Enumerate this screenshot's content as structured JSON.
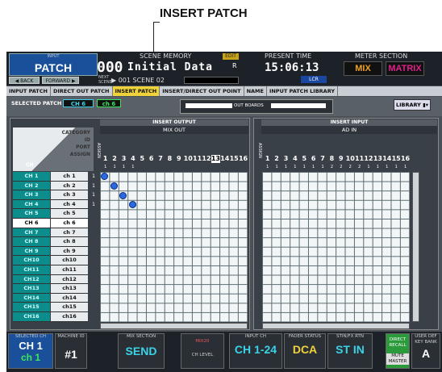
{
  "caption": "INSERT PATCH",
  "header": {
    "function_top": "INPUT",
    "function_name": "PATCH",
    "back": "◀ BACK",
    "forward": "FORWARD ▶",
    "scene_label": "SCENE MEMORY",
    "scene_number": "000",
    "scene_title": "Initial Data",
    "edit": "EDIT",
    "r": "R",
    "next_label_1": "NEXT",
    "next_label_2": "SCENE",
    "next_value": "▶ 001 SCENE 02",
    "time_label": "PRESENT TIME",
    "time": "15:06:13",
    "lcr": "LCR",
    "meter_label": "METER SECTION",
    "mix": "MIX",
    "matrix": "MATRIX",
    "colors": {
      "mix": "#f0a020",
      "matrix": "#e0208a"
    }
  },
  "tabs": [
    "INPUT PATCH",
    "DIRECT OUT PATCH",
    "INSERT PATCH",
    "INSERT/DIRECT OUT POINT",
    "NAME",
    "INPUT PATCH LIBRARY"
  ],
  "active_tab": "INSERT PATCH",
  "selected_patch": {
    "label": "SELECTED PATCH",
    "ch": "CH 6",
    "port": "ch 6"
  },
  "out_boards": "OUT BOARDS",
  "library": "LIBRARY",
  "row_labels": [
    "CATEGORY",
    "ID",
    "PORT",
    "ASSIGN"
  ],
  "ch_header": "CH",
  "insert_output": {
    "title": "INSERT OUTPUT",
    "sub": "MIX OUT",
    "assign": "ASSIGN",
    "numbers": [
      "1",
      "2",
      "3",
      "4",
      "5",
      "6",
      "7",
      "8",
      "9",
      "10",
      "11",
      "12",
      "13",
      "14",
      "15",
      "16"
    ],
    "ticks": [
      "1",
      "1",
      "1",
      "1",
      "",
      "",
      "",
      "",
      "",
      "",
      "",
      "",
      "",
      "",
      "",
      ""
    ]
  },
  "insert_input": {
    "title": "INSERT INPUT",
    "sub": "AD IN",
    "assign": "ASSIGN",
    "numbers": [
      "1",
      "2",
      "3",
      "4",
      "5",
      "6",
      "7",
      "8",
      "9",
      "10",
      "11",
      "12",
      "13",
      "14",
      "15",
      "16"
    ],
    "ticks": [
      "1",
      "1",
      "1",
      "1",
      "1",
      "1",
      "1",
      "2",
      "2",
      "2",
      "2",
      "1",
      "1",
      "1",
      "1",
      "1"
    ]
  },
  "channels": [
    "CH 1",
    "CH 2",
    "CH 3",
    "CH 4",
    "CH 5",
    "CH 6",
    "CH 7",
    "CH 8",
    "CH 9",
    "CH10",
    "CH11",
    "CH12",
    "CH13",
    "CH14",
    "CH15",
    "CH16"
  ],
  "ports": [
    "ch 1",
    "ch 2",
    "ch 3",
    "ch 4",
    "ch 5",
    "ch 6",
    "ch 7",
    "ch 8",
    "ch 9",
    "ch10",
    "ch11",
    "ch12",
    "ch13",
    "ch14",
    "ch15",
    "ch16"
  ],
  "assign_marks": [
    "1",
    "1",
    "1",
    "1",
    "",
    "",
    "",
    "",
    "",
    "",
    "",
    "",
    "",
    "",
    "",
    ""
  ],
  "selected_row": 6,
  "patches": [
    1,
    2,
    3,
    4
  ],
  "footer": {
    "selected_ch_label": "SELECTED CH",
    "selected_ch": "CH 1",
    "selected_ch_port": "ch 1",
    "machine_label": "MACHINE ID",
    "machine": "#1",
    "mix_section_label": "MIX SECTION",
    "send": "SEND",
    "mix_small": "MIX20",
    "ch_level": "CH LEVEL",
    "input_ch_label": "INPUT CH",
    "input_ch": "CH 1-24",
    "fader_label": "FADER STATUS",
    "dca": "DCA",
    "stin_label": "STIN/FX RTN",
    "st_in": "ST IN",
    "direct_recall": "DIRECT RECALL",
    "mute_master": "MUTE MASTER",
    "user_def_label": "USER DEF KEY BANK",
    "user_bank": "A"
  }
}
